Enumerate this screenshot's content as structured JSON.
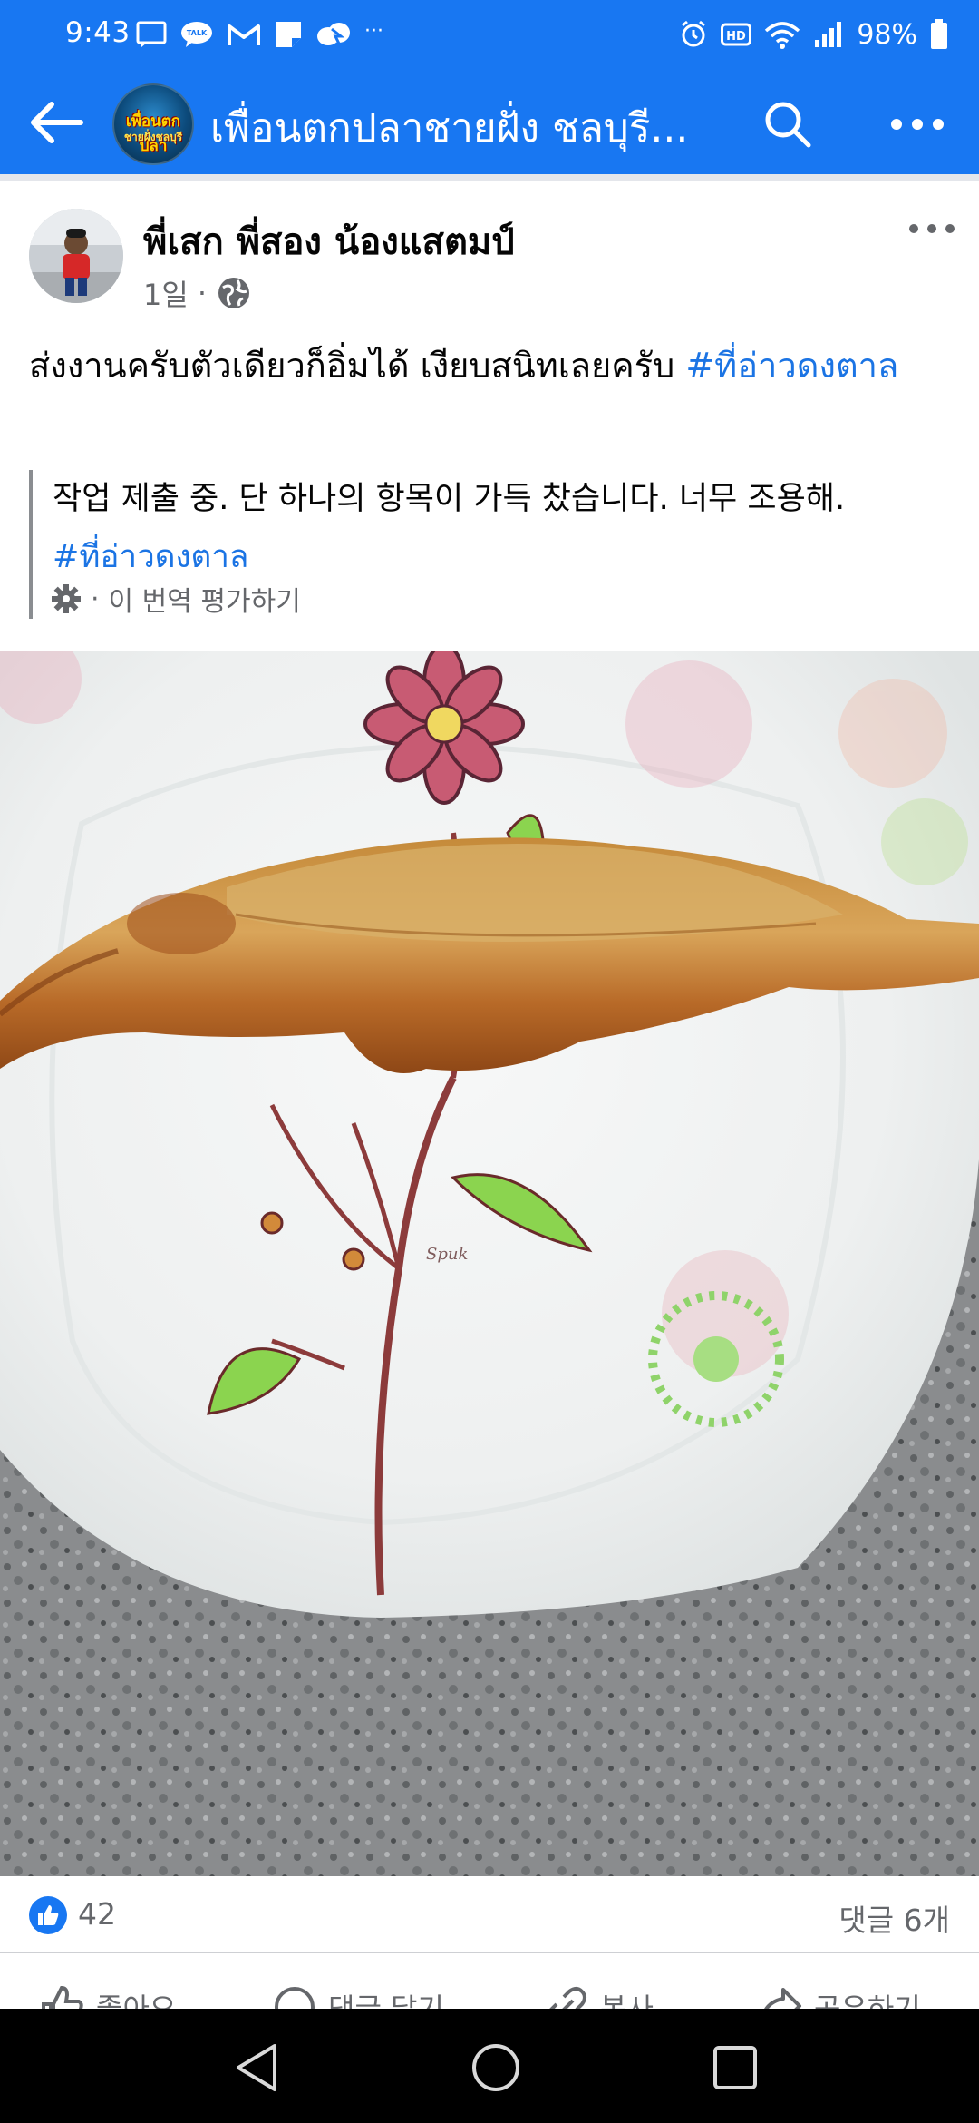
{
  "status_bar": {
    "time": "9:43",
    "battery_text": "98%",
    "left_icons": [
      "message-icon",
      "talk-icon",
      "gmail-icon",
      "note-icon",
      "cloud-icon",
      "more-dots-icon"
    ],
    "right_icons": [
      "alarm-icon",
      "hd-icon",
      "wifi-icon",
      "signal-icon",
      "battery-icon"
    ],
    "talk_text": "TALK",
    "hd_text": "HD",
    "more_text": "···"
  },
  "app_bar": {
    "title": "เพื่อนตกปลาชายฝั่ง ชลบุรี...",
    "group_avatar_text_1": "เพื่อนตกปลา",
    "group_avatar_text_2": "ชายฝั่งชลบุรี"
  },
  "post": {
    "author": "พี่เสก พี่สอง น้องแสตมป์",
    "time": "1일",
    "separator": "·",
    "text_plain": "ส่งงานครับตัวเดียวก็อิ่มได้ เงียบสนิทเลยครับ ",
    "hashtag": "#ที่อ่าวดงตาล",
    "translation_text": "작업 제출 중. 단 하나의 항목이 가득 찼습니다. 너무 조용해.",
    "translation_hashtag": "#ที่อ่าวดงตาล",
    "translation_rate": "이 번역 평가하기",
    "photo_signature": "Spuk"
  },
  "reactions": {
    "like_count": "42",
    "comment_count": "댓글 6개"
  },
  "actions": [
    {
      "label": "좋아요"
    },
    {
      "label": "댓글 달기"
    },
    {
      "label": "복사"
    },
    {
      "label": "공유하기"
    }
  ],
  "colors": {
    "brand_blue": "#1877f2",
    "hashtag_blue": "#1b74e4",
    "meta_gray": "#65676b"
  }
}
